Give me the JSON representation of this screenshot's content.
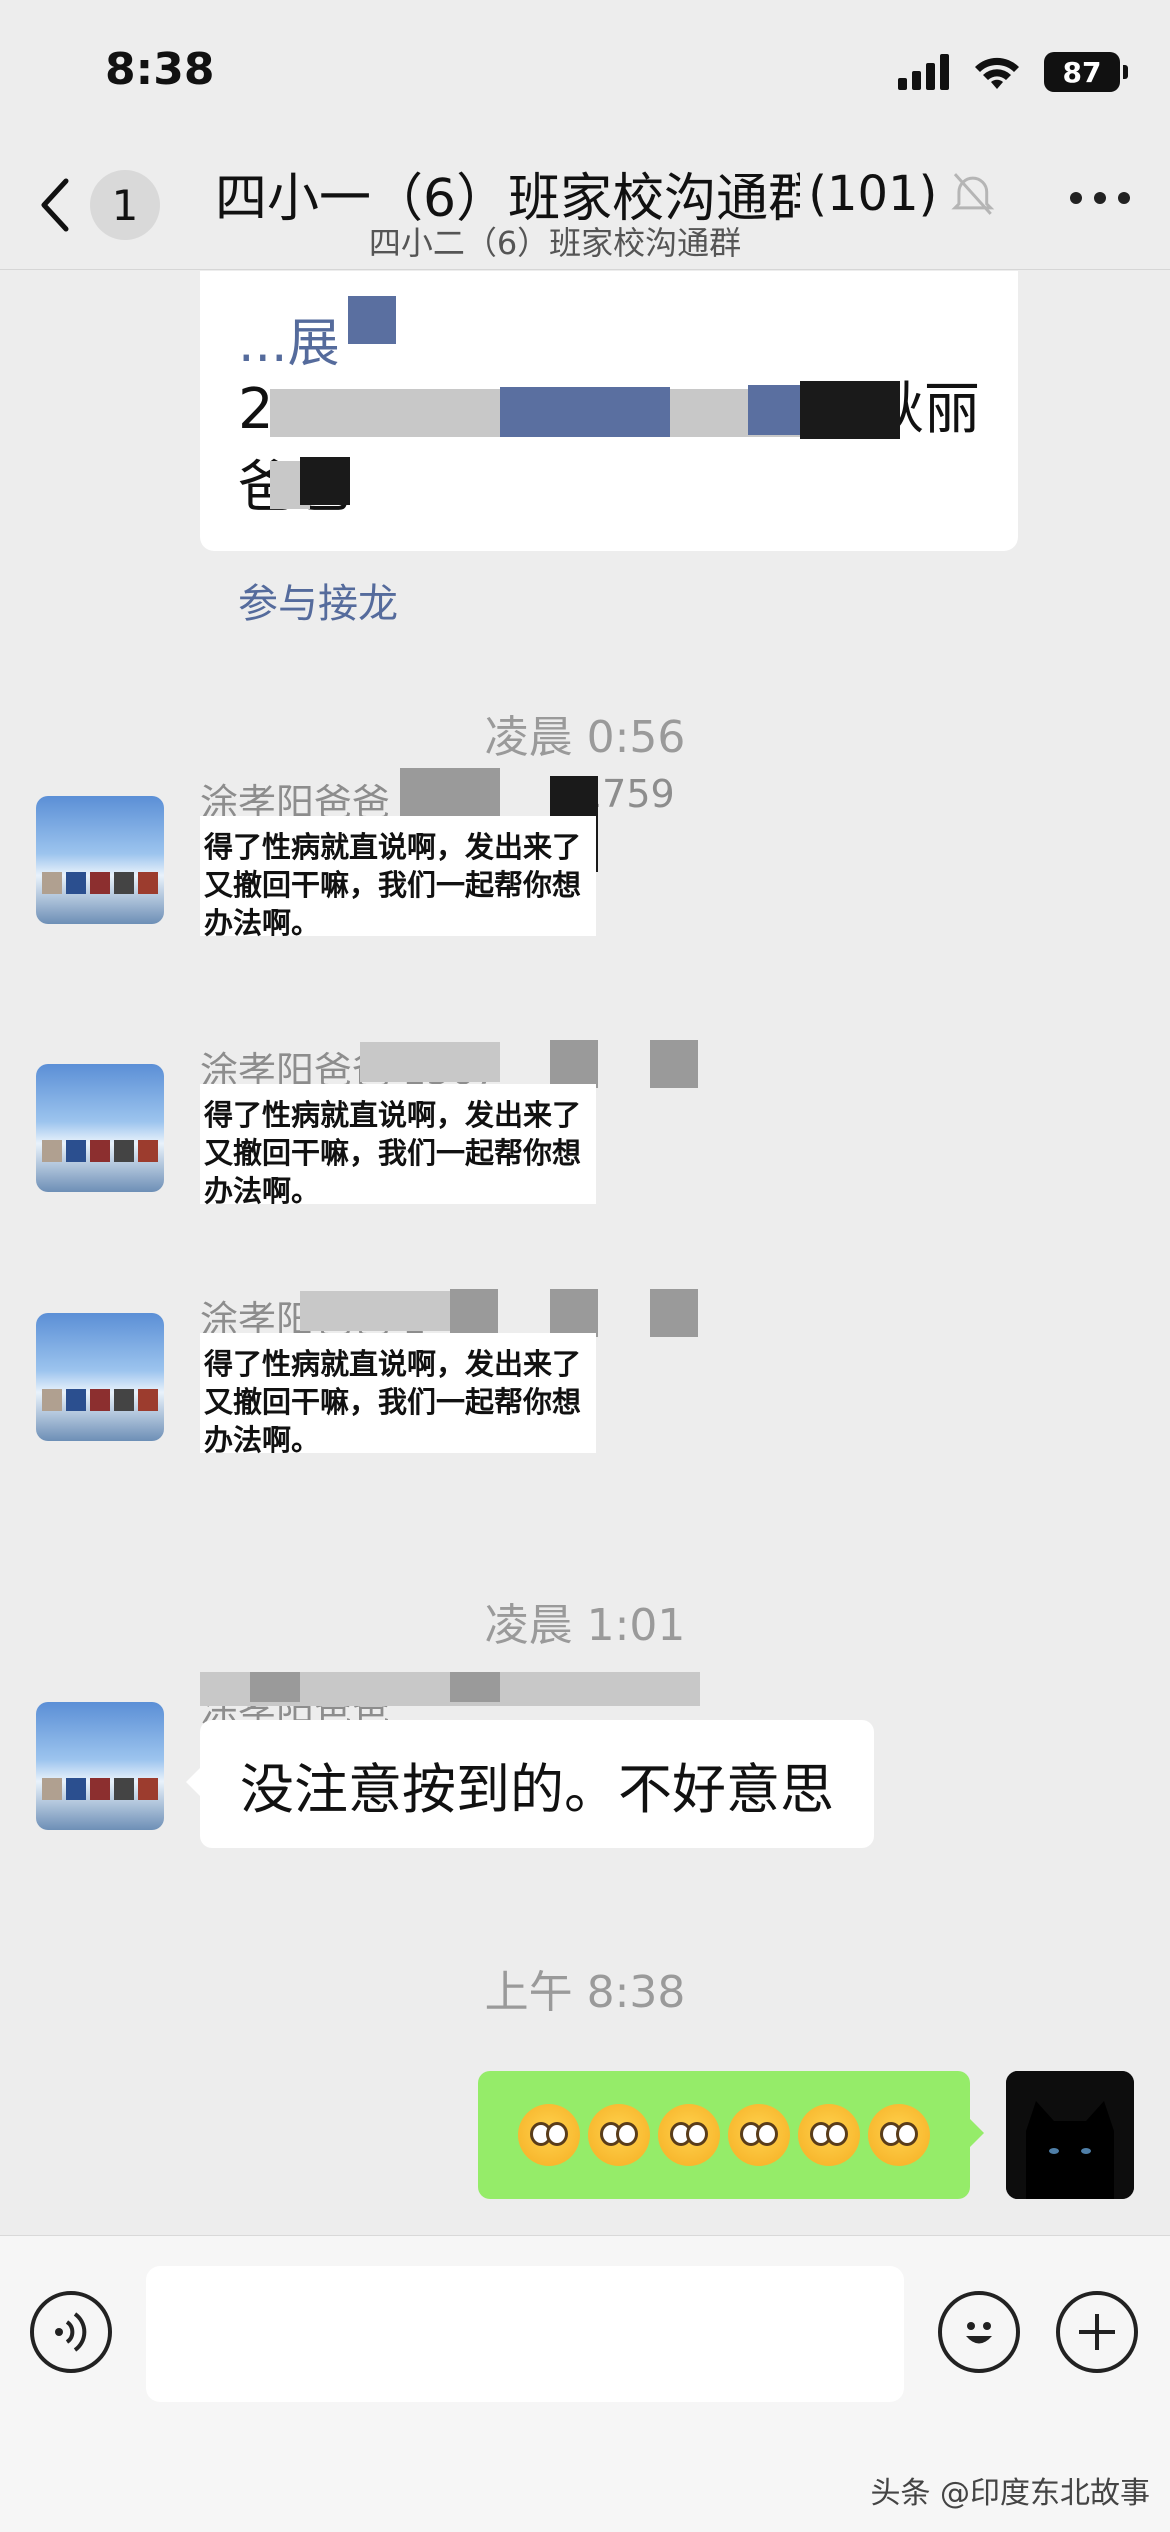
{
  "status_bar": {
    "time": "8:38",
    "battery": "87"
  },
  "header": {
    "back_count": "1",
    "title": "四小一（6）班家校沟通群",
    "member_count": "(101)",
    "subtitle": "四小二（6）班家校沟通群"
  },
  "solitaire": {
    "line1": "...展",
    "line2_start": "2",
    "line2_end": "秋丽",
    "line3": "爸爸",
    "join_label": "参与接龙"
  },
  "timestamps": [
    "凌晨 0:56",
    "凌晨 1:01",
    "上午 8:38"
  ],
  "messages": [
    {
      "sender": "涂孝阳爸爸 1",
      "sender_tail": "1759",
      "text": "得了性病就直说啊，发出来了又撤回干嘛，我们一起帮你想办法啊。"
    },
    {
      "sender": "涂孝阳爸爸 1567",
      "text": "得了性病就直说啊，发出来了又撤回干嘛，我们一起帮你想办法啊。"
    },
    {
      "sender": "涂孝阳爸爸 1",
      "text": "得了性病就直说啊，发出来了又撤回干嘛，我们一起帮你想办法啊。"
    },
    {
      "sender": "涂孝阳爸爸",
      "text": "没注意按到的。不好意思"
    }
  ],
  "my_message": {
    "emoji": "😳😳😳😳😳😳",
    "count": 6
  },
  "input_bar": {
    "placeholder": ""
  },
  "watermark": "头条 @印度东北故事",
  "icons": {
    "back": "chevron-left-icon",
    "mute": "bell-slash-icon",
    "more": "more-dots-icon",
    "voice": "voice-icon",
    "emoji": "emoji-icon",
    "plus": "plus-icon"
  },
  "colors": {
    "my_bubble": "#95ec69",
    "link": "#556b9c",
    "background": "#ededed"
  }
}
